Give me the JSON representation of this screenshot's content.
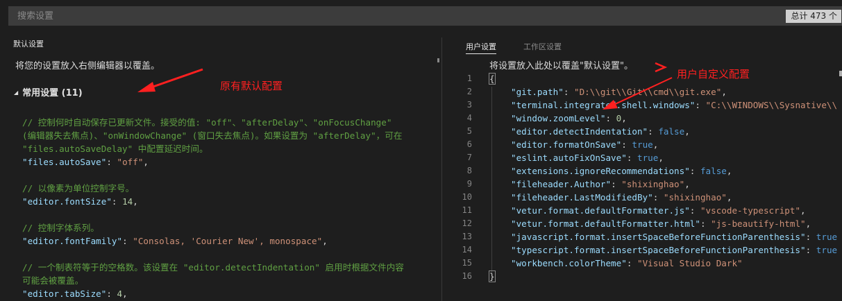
{
  "search": {
    "placeholder": "搜索设置",
    "count": "总计 473 个"
  },
  "default_pane": {
    "title": "默认设置",
    "hint": "将您的设置放入右侧编辑器以覆盖。",
    "group_title": "常用设置 (11)",
    "lines": [
      {
        "cmt": "// 控制何时自动保存已更新文件。接受的值: \"off\"、\"afterDelay\"、\"onFocusChange\""
      },
      {
        "cmt": "(编辑器失去焦点)、\"onWindowChange\" (窗口失去焦点)。如果设置为 \"afterDelay\"，可在"
      },
      {
        "cmt": "\"files.autoSaveDelay\" 中配置延迟时间。"
      },
      {
        "key": "\"files.autoSave\"",
        "sep": ": ",
        "val": "\"off\"",
        "vtype": "str",
        "end": ","
      },
      {
        "cmt": "// 以像素为单位控制字号。"
      },
      {
        "key": "\"editor.fontSize\"",
        "sep": ": ",
        "val": "14",
        "vtype": "num",
        "end": ","
      },
      {
        "cmt": "// 控制字体系列。"
      },
      {
        "key": "\"editor.fontFamily\"",
        "sep": ": ",
        "val": "\"Consolas, 'Courier New', monospace\"",
        "vtype": "str",
        "end": ","
      },
      {
        "cmt": "// 一个制表符等于的空格数。该设置在 \"editor.detectIndentation\" 启用时根据文件内容"
      },
      {
        "cmt": "可能会被覆盖。"
      },
      {
        "key": "\"editor.tabSize\"",
        "sep": ": ",
        "val": "4",
        "vtype": "num",
        "end": ","
      }
    ]
  },
  "user_pane": {
    "tabs": [
      {
        "label": "用户设置",
        "active": true
      },
      {
        "label": "工作区设置",
        "active": false
      }
    ],
    "hint": "将设置放入此处以覆盖\"默认设置\"。",
    "line_numbers": [
      "1",
      "2",
      "3",
      "4",
      "5",
      "6",
      "7",
      "8",
      "9",
      "10",
      "11",
      "12",
      "13",
      "14",
      "15",
      "16"
    ],
    "open_brace": "{",
    "close_brace": "}",
    "entries": [
      {
        "key": "\"git.path\"",
        "val": "\"D:\\\\git\\\\Git\\\\cmd\\\\git.exe\"",
        "vtype": "str",
        "end": ","
      },
      {
        "key": "\"terminal.integrated.shell.windows\"",
        "val": "\"C:\\\\WINDOWS\\\\Sysnative\\\\",
        "vtype": "str",
        "end": ""
      },
      {
        "key": "\"window.zoomLevel\"",
        "val": "0",
        "vtype": "num",
        "end": ","
      },
      {
        "key": "\"editor.detectIndentation\"",
        "val": "false",
        "vtype": "kw",
        "end": ","
      },
      {
        "key": "\"editor.formatOnSave\"",
        "val": "true",
        "vtype": "kw",
        "end": ","
      },
      {
        "key": "\"eslint.autoFixOnSave\"",
        "val": "true",
        "vtype": "kw",
        "end": ","
      },
      {
        "key": "\"extensions.ignoreRecommendations\"",
        "val": "false",
        "vtype": "kw",
        "end": ","
      },
      {
        "key": "\"fileheader.Author\"",
        "val": "\"shixinghao\"",
        "vtype": "str",
        "end": ","
      },
      {
        "key": "\"fileheader.LastModifiedBy\"",
        "val": "\"shixinghao\"",
        "vtype": "str",
        "end": ","
      },
      {
        "key": "\"vetur.format.defaultFormatter.js\"",
        "val": "\"vscode-typescript\"",
        "vtype": "str",
        "end": ","
      },
      {
        "key": "\"vetur.format.defaultFormatter.html\"",
        "val": "\"js-beautify-html\"",
        "vtype": "str",
        "end": ","
      },
      {
        "key": "\"javascript.format.insertSpaceBeforeFunctionParenthesis\"",
        "val": "true",
        "vtype": "kw",
        "end": ""
      },
      {
        "key": "\"typescript.format.insertSpaceBeforeFunctionParenthesis\"",
        "val": "true",
        "vtype": "kw",
        "end": ""
      },
      {
        "key": "\"workbench.colorTheme\"",
        "val": "\"Visual Studio Dark\"",
        "vtype": "str",
        "end": ""
      }
    ]
  },
  "annotations": {
    "default_label": "原有默认配置",
    "user_label": "用户自定义配置",
    "color": "#ff2020"
  }
}
